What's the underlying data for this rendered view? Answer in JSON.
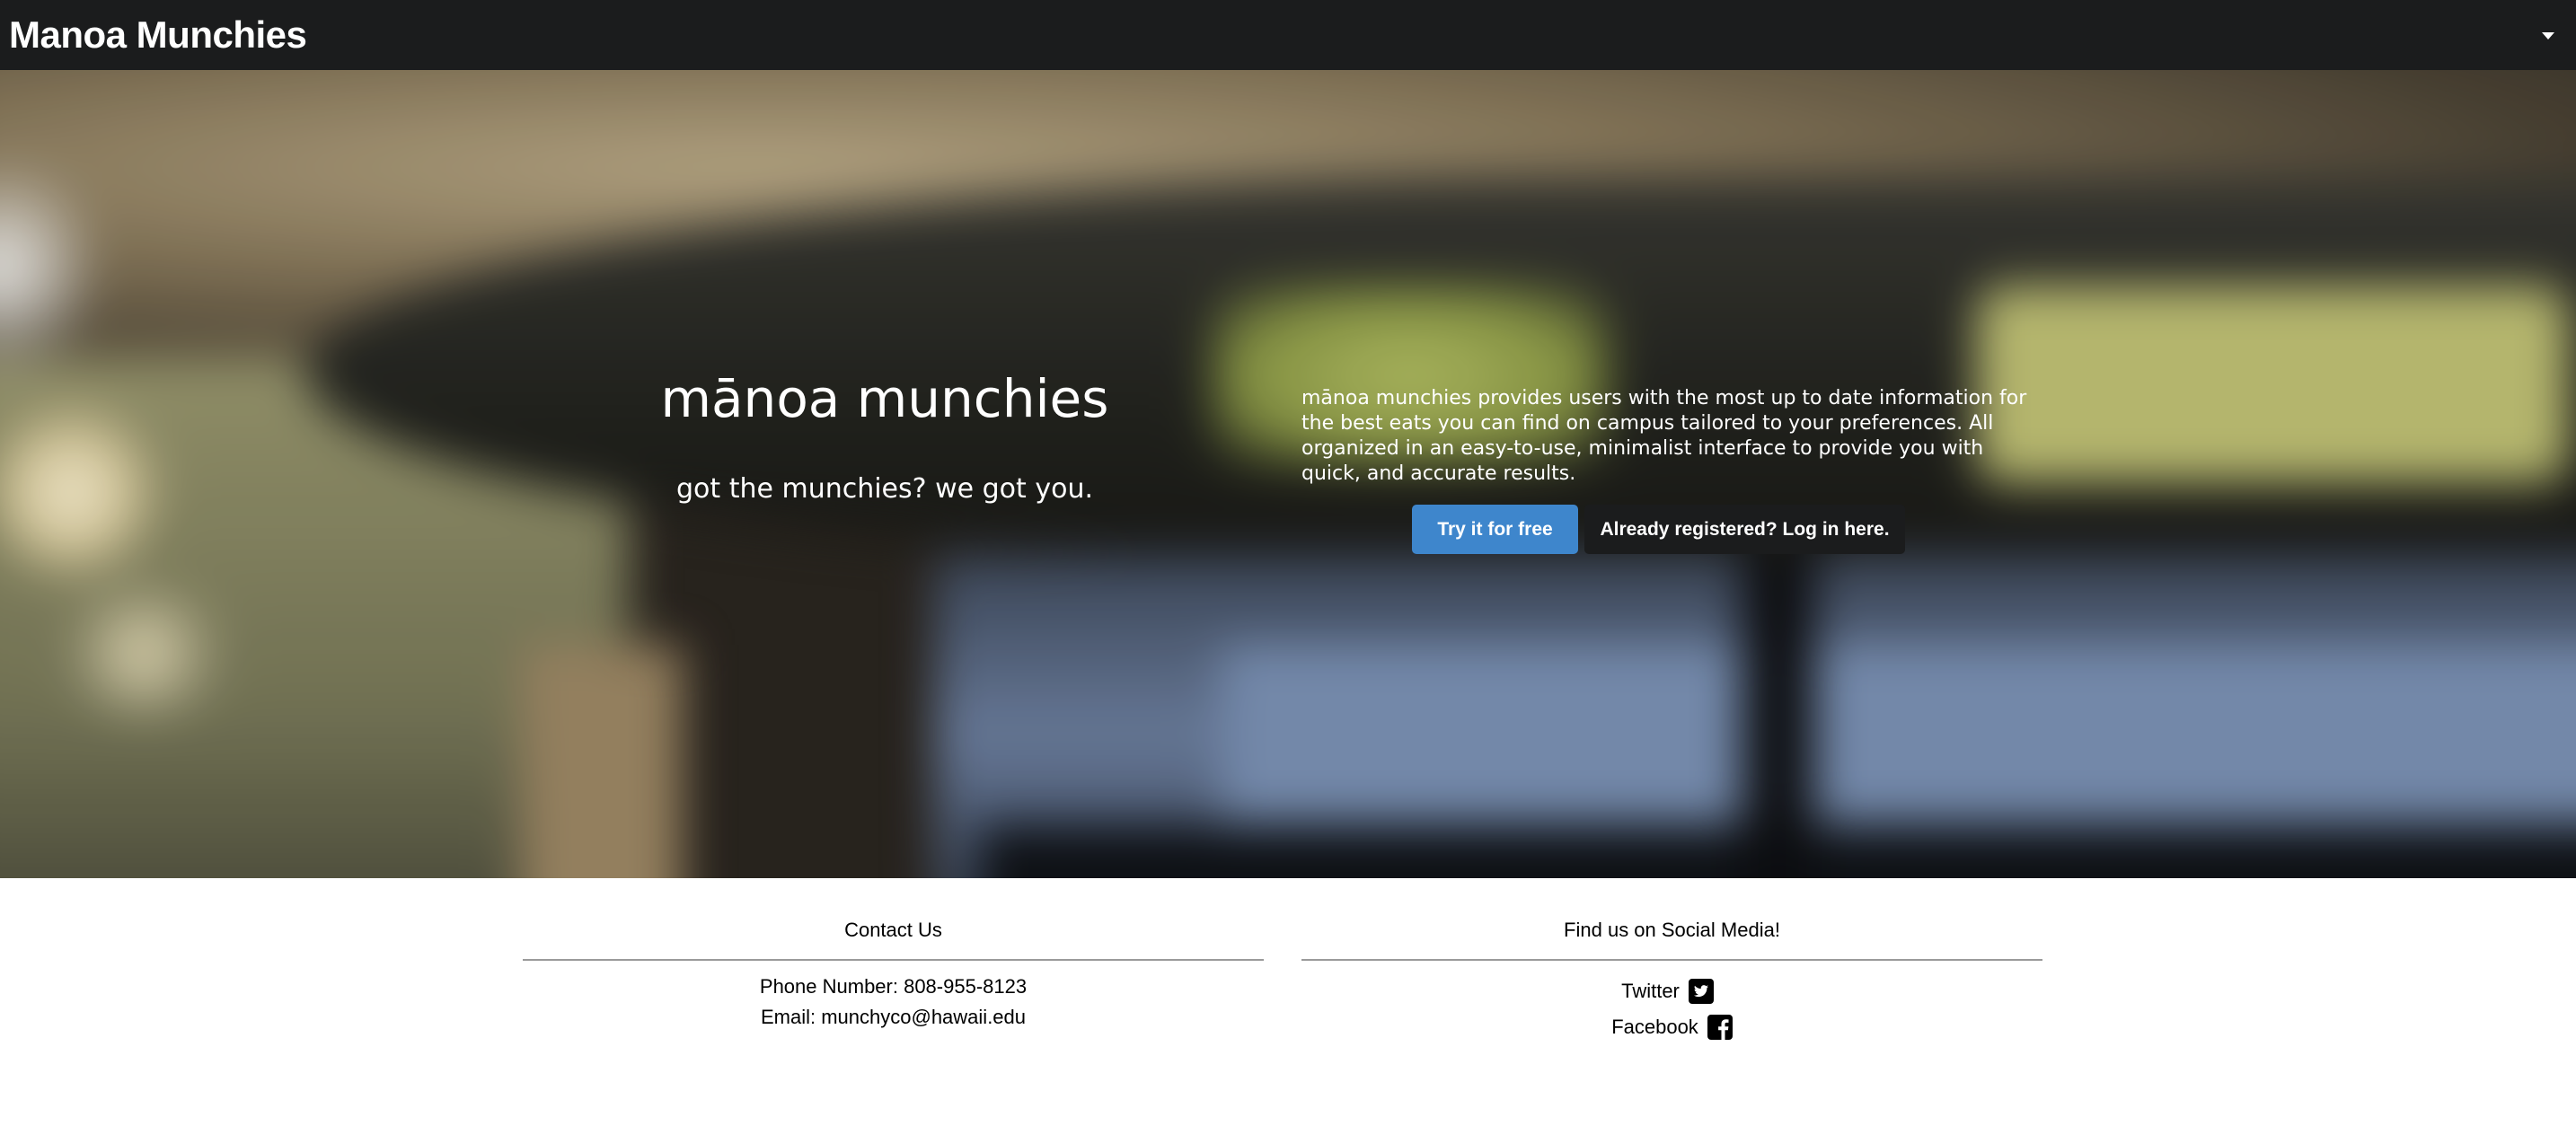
{
  "navbar": {
    "brand": "Manoa Munchies",
    "menu_icon": "caret-down-icon"
  },
  "hero": {
    "title": "mānoa munchies",
    "subtitle": "got the munchies? we got you.",
    "description": "mānoa munchies provides users with the most up to date information for the best eats you can find on campus tailored to your preferences. All organized in an easy-to-use, minimalist interface to provide you with quick, and accurate results.",
    "try_button": "Try it for free",
    "login_button": "Already registered? Log in here."
  },
  "footer": {
    "contact": {
      "heading": "Contact Us",
      "phone": "Phone Number: 808-955-8123",
      "email": "Email: munchyco@hawaii.edu"
    },
    "social": {
      "heading": "Find us on Social Media!",
      "twitter": "Twitter",
      "twitter_icon": "twitter-square-icon",
      "facebook": "Facebook",
      "facebook_icon": "facebook-square-icon"
    }
  },
  "colors": {
    "navbar": "#1b1c1d",
    "primary_button": "#3e86cc",
    "dark_button": "#1b1c1d"
  }
}
